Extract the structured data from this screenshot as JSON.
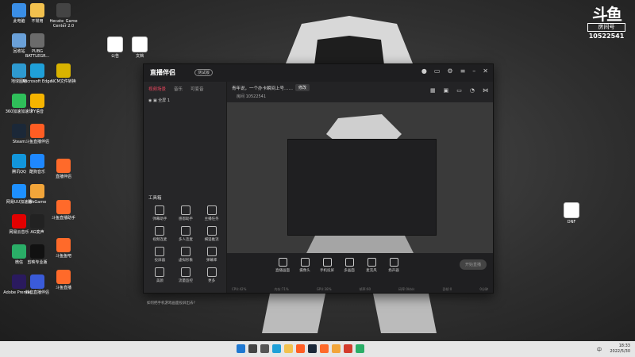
{
  "desktop": {
    "icons": [
      {
        "label": "此电脑",
        "icon": "monitor-icon",
        "color": "#3a8ee6"
      },
      {
        "label": "回收站",
        "icon": "recycle-bin-icon",
        "color": "#6aa0d8"
      },
      {
        "label": "地球图标",
        "icon": "earth-icon",
        "color": "#2e9ad0"
      },
      {
        "label": "360加速加速球",
        "icon": "accelerator-icon",
        "color": "#2fbf5a"
      },
      {
        "label": "Steam",
        "icon": "steam-icon",
        "color": "#1b2838"
      },
      {
        "label": "腾讯QQ",
        "icon": "qq-icon",
        "color": "#1296db"
      },
      {
        "label": "网易UU加速器",
        "icon": "uu-icon",
        "color": "#1e90ff"
      },
      {
        "label": "网易云音乐",
        "icon": "music-icon",
        "color": "#e20000"
      },
      {
        "label": "微信",
        "icon": "wechat-icon",
        "color": "#2aae67"
      },
      {
        "label": "Adobe Premie...",
        "icon": "premiere-icon",
        "color": "#2a1a5e"
      },
      {
        "label": "不常用",
        "icon": "folder-icon",
        "color": "#f2c14e"
      },
      {
        "label": "PUBG BATTLEGR...",
        "icon": "pubg-icon",
        "color": "#6b6b6b"
      },
      {
        "label": "Microsoft Edge",
        "icon": "edge-icon",
        "color": "#1fa0d8"
      },
      {
        "label": "YY语音",
        "icon": "yy-icon",
        "color": "#f5b400"
      },
      {
        "label": "斗鱼直播伴侣",
        "icon": "douyu-icon",
        "color": "#ff5d23"
      },
      {
        "label": "酷狗音乐",
        "icon": "kugou-icon",
        "color": "#1e88ff"
      },
      {
        "label": "WeGame",
        "icon": "wegame-icon",
        "color": "#f2a53a"
      },
      {
        "label": "AG变声",
        "icon": "ag-icon",
        "color": "#222222"
      },
      {
        "label": "剪映专业版",
        "icon": "jianying-icon",
        "color": "#111111"
      },
      {
        "label": "抖音直播伴侣",
        "icon": "tiktok-icon",
        "color": "#3a5bd9"
      },
      {
        "label": "Hecate_Game Center 2.0",
        "icon": "hecate-icon",
        "color": "#444444"
      },
      {
        "label": "NCM文件转换",
        "icon": "ncm-icon",
        "color": "#d8b300"
      },
      {
        "label": "直播伴侣",
        "icon": "live-icon",
        "color": "#ff6a2a"
      },
      {
        "label": "斗鱼直播助手",
        "icon": "assistant-icon",
        "color": "#ff6a2a"
      },
      {
        "label": "斗鱼鱼吧",
        "icon": "fish-icon",
        "color": "#ff6a2a"
      },
      {
        "label": "斗鱼直播",
        "icon": "douyu-live-icon",
        "color": "#ff6a2a"
      },
      {
        "label": "公告",
        "icon": "doc-icon",
        "color": "#ffffff"
      },
      {
        "label": "文档",
        "icon": "doc2-icon",
        "color": "#ffffff"
      },
      {
        "label": "DNF",
        "icon": "dnf-file-icon",
        "color": "#ffffff"
      }
    ]
  },
  "watermark": {
    "logo": "斗鱼",
    "room_label": "房间号",
    "room_number": "10522541"
  },
  "app": {
    "title": "直播伴侣",
    "badge": "测试版",
    "left_tabs": [
      "视频场景",
      "音乐",
      "可变音"
    ],
    "scene_name": "全屏 1",
    "tools_title": "工具箱",
    "tools": [
      "弹幕助手",
      "感恩助手",
      "主播任务",
      "视频连麦",
      "多人连麦",
      "横竖推流",
      "投屏器",
      "虚拟形象",
      "弹幕库",
      "美颜",
      "流量监控",
      "更多"
    ],
    "notice": "如何把手机游戏画面投屏出去?",
    "room_title": "青年说，一个办卡瞬间上号……",
    "modify_label": "修改",
    "room_id_label": "房间 10522541",
    "bottom_buttons": [
      "直播画面",
      "摄像头",
      "手机投屏",
      "多画面",
      "麦克风",
      "扬声器"
    ],
    "live_button": "开始直播",
    "status_items": [
      "CPU:42%",
      "内存:71%",
      "GPU:38%",
      "帧率:60",
      "码率:0kb/s",
      "丢帧:0",
      "0分钟"
    ]
  },
  "taskbar": {
    "time": "18:33",
    "date": "2022/5/30",
    "lang": "中",
    "apps": [
      {
        "icon": "windows-start-icon",
        "color": "#1f78d1"
      },
      {
        "icon": "search-icon",
        "color": "#444444"
      },
      {
        "icon": "task-view-icon",
        "color": "#555555"
      },
      {
        "icon": "edge-taskbar-icon",
        "color": "#1fa0d8"
      },
      {
        "icon": "explorer-icon",
        "color": "#f2c14e"
      },
      {
        "icon": "douyu-taskbar-icon",
        "color": "#ff5d23"
      },
      {
        "icon": "steam-taskbar-icon",
        "color": "#1b2838"
      },
      {
        "icon": "live-taskbar-icon",
        "color": "#ff6a2a"
      },
      {
        "icon": "wegame-taskbar-icon",
        "color": "#f2a53a"
      },
      {
        "icon": "chrome-taskbar-icon",
        "color": "#d33b2c"
      },
      {
        "icon": "wechat-taskbar-icon",
        "color": "#2aae67"
      }
    ]
  }
}
